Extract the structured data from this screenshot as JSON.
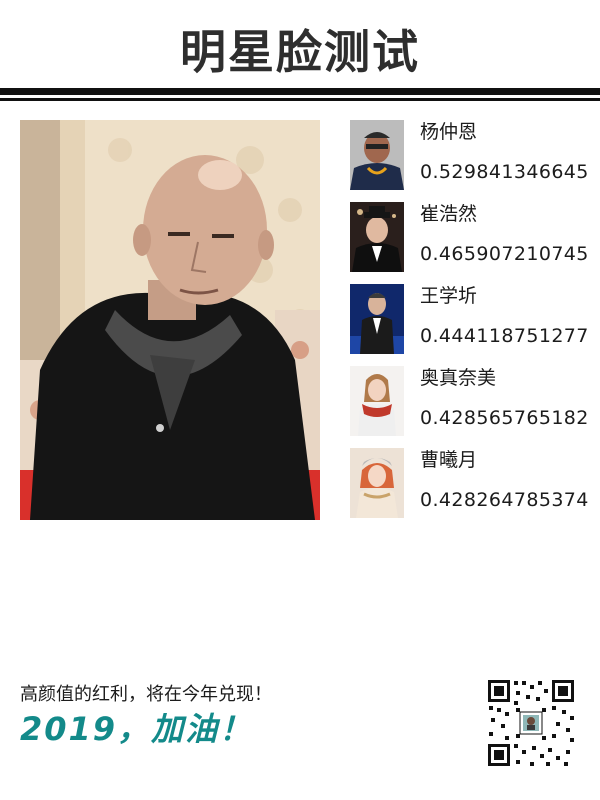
{
  "header": {
    "title": "明星脸测试"
  },
  "matches": [
    {
      "name": "杨仲恩",
      "score": "0.529841346645",
      "similarity": 0.529841346645
    },
    {
      "name": "崔浩然",
      "score": "0.465907210745",
      "similarity": 0.465907210745
    },
    {
      "name": "王学圻",
      "score": "0.444118751277",
      "similarity": 0.444118751277
    },
    {
      "name": "奥真奈美",
      "score": "0.428565765182",
      "similarity": 0.428565765182
    },
    {
      "name": "曹曦月",
      "score": "0.428264785374",
      "similarity": 0.428264785374
    }
  ],
  "footer": {
    "slogan": "高颜值的红利，将在今年兑现！",
    "cheer": "2019，加油！"
  },
  "colors": {
    "title": "#2e2e2e",
    "rule": "#111111",
    "cheer_accent": "#138a8a",
    "text": "#1c1c1c"
  },
  "icons": {
    "main_photo": "user-portrait-photo",
    "thumbnails": "celebrity-thumbnail-photo",
    "qr": "qr-code-icon"
  }
}
